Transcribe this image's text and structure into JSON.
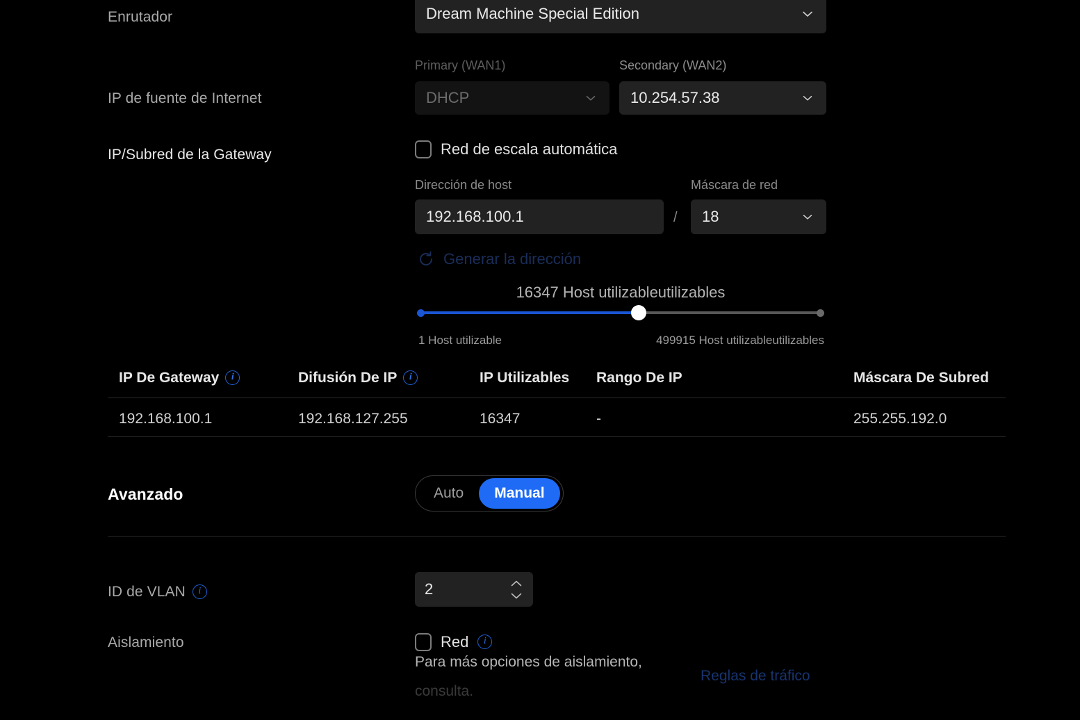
{
  "theme": {
    "background": "#000000",
    "field_bg": "#222222",
    "accent_blue": "#1f6bf5",
    "slider_blue": "#1a55d4",
    "info_blue": "#2f6fe0",
    "text_primary": "#e9e9e9",
    "text_muted": "#8c8c8c"
  },
  "router_row": {
    "label": "Enrutador",
    "value": "Dream Machine Special Edition",
    "chevron_icon": "chevron-down-icon"
  },
  "internet_source_row": {
    "label": "IP de fuente de Internet",
    "primary": {
      "caption": "Primary (WAN1)",
      "value": "DHCP",
      "disabled": true,
      "chevron_icon": "chevron-down-icon"
    },
    "secondary": {
      "caption": "Secondary (WAN2)",
      "value": "10.254.57.38",
      "disabled": false,
      "chevron_icon": "chevron-down-icon"
    }
  },
  "gateway_row": {
    "label": "IP/Subred de la Gateway",
    "auto_scale_checkbox": {
      "label": "Red de escala automática",
      "checked": false,
      "icon": "checkbox-unchecked-icon"
    },
    "host_address": {
      "caption": "Dirección de host",
      "value": "192.168.100.1"
    },
    "separator": "/",
    "netmask": {
      "caption": "Máscara de red",
      "value": "18",
      "chevron_icon": "chevron-down-icon"
    },
    "generate_link": {
      "label": "Generar la dirección",
      "icon": "refresh-icon",
      "disabled": true
    }
  },
  "host_slider": {
    "title": "16347 Host utilizableutilizables",
    "min_label": "1 Host utilizable",
    "max_label": "499915 Host utilizableutilizables",
    "value": 16347,
    "min": 1,
    "max": 499915,
    "fill_percent": 54
  },
  "subnet_table": {
    "columns": [
      {
        "label": "IP De Gateway",
        "info_icon": "info-icon"
      },
      {
        "label": "Difusión De IP",
        "info_icon": "info-icon"
      },
      {
        "label": "IP Utilizables",
        "info_icon": null
      },
      {
        "label": "Rango De IP",
        "info_icon": null
      },
      {
        "label": "Máscara De Subred",
        "info_icon": null
      }
    ],
    "rows": [
      {
        "gateway_ip": "192.168.100.1",
        "broadcast_ip": "192.168.127.255",
        "usable_ips": "16347",
        "ip_range": "-",
        "subnet_mask": "255.255.192.0"
      }
    ]
  },
  "advanced": {
    "label": "Avanzado",
    "options": [
      "Auto",
      "Manual"
    ],
    "selected": "Manual"
  },
  "vlan_row": {
    "label": "ID de VLAN",
    "info_icon": "info-icon",
    "value": "2",
    "increment_icon": "chevron-up-icon",
    "decrement_icon": "chevron-down-icon"
  },
  "isolation_row": {
    "label": "Aislamiento",
    "checkbox": {
      "label": "Red",
      "checked": false,
      "icon": "checkbox-unchecked-icon",
      "info_icon": "info-icon"
    },
    "help_text_line1": "Para más opciones de aislamiento,",
    "help_text_line2": "consulta.",
    "link_label": "Reglas de tráfico"
  }
}
